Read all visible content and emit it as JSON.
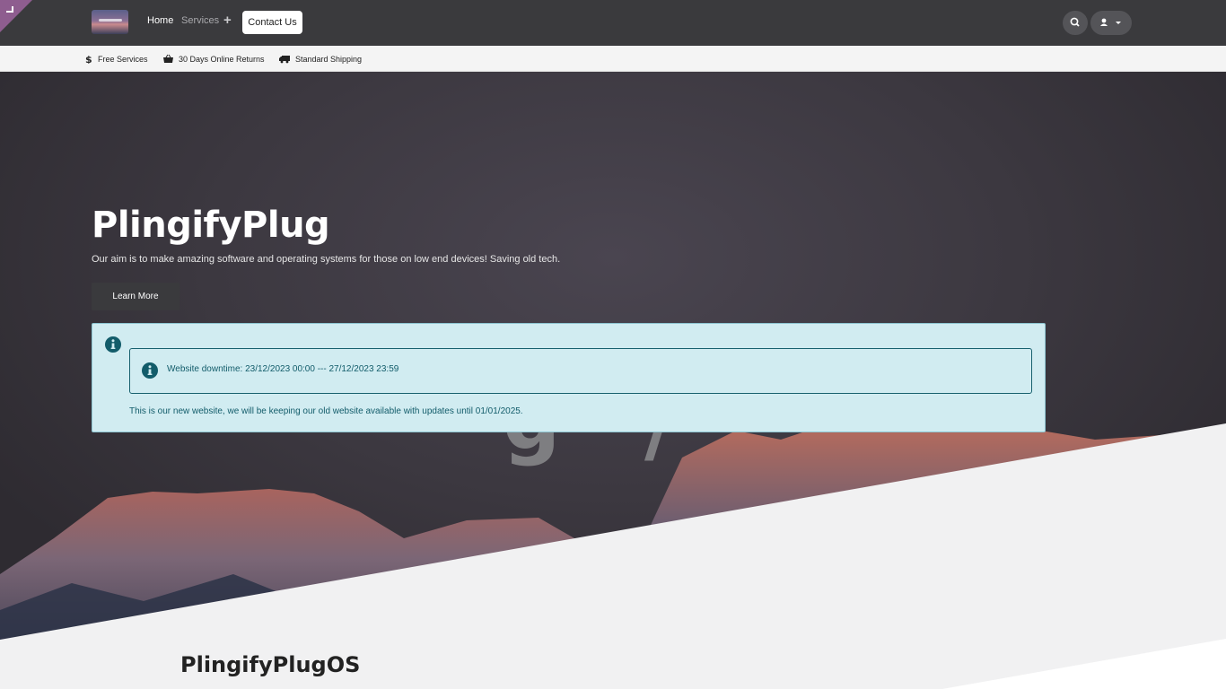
{
  "nav": {
    "home": "Home",
    "services": "Services",
    "plus": "+",
    "contact": "Contact Us"
  },
  "infobar": {
    "items": [
      {
        "label": "Free Services",
        "icon": "dollar-icon"
      },
      {
        "label": "30 Days Online Returns",
        "icon": "basket-icon"
      },
      {
        "label": "Standard Shipping",
        "icon": "truck-icon"
      }
    ]
  },
  "hero": {
    "title": "PlingifyPlug",
    "subtitle": "Our aim is to make amazing software and operating systems for those on low end devices! Saving old tech.",
    "button": "Learn More"
  },
  "alert": {
    "downtime": "Website downtime: 23/12/2023 00:00 --- 27/12/2023 23:59",
    "message": "This is our new website, we will be keeping our old website available with updates until 01/01/2025."
  },
  "section": {
    "title": "PlingifyPlugOS"
  },
  "colors": {
    "navbar": "#3a3a3d",
    "alert_bg": "#d1ecf1",
    "alert_text": "#125c6a",
    "corner": "#8e5d8f"
  }
}
